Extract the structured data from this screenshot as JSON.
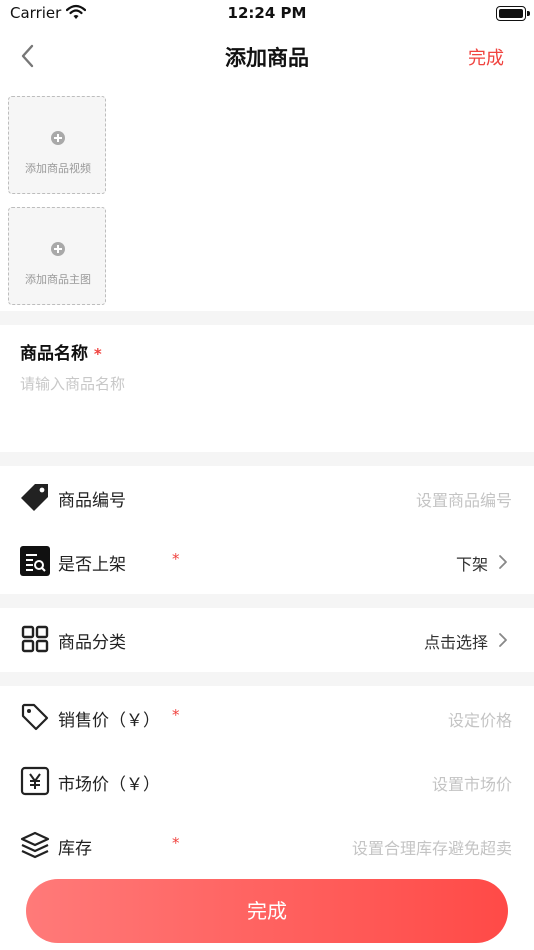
{
  "status_bar": {
    "carrier": "Carrier",
    "time": "12:24 PM",
    "wifi_icon": "wifi-icon",
    "battery_icon": "battery-icon"
  },
  "nav": {
    "back_icon": "chevron-left-icon",
    "title": "添加商品",
    "done_label": "完成"
  },
  "media": {
    "video_label": "添加商品视频",
    "image_label": "添加商品主图",
    "add_icon": "plus-circle-icon"
  },
  "name_field": {
    "label": "商品名称",
    "required_mark": "*",
    "placeholder": "请输入商品名称"
  },
  "rows": [
    {
      "icon": "tag-icon",
      "label": "商品编号",
      "value": "设置商品编号"
    },
    {
      "icon": "listing-icon",
      "label": "是否上架",
      "required_mark": "*",
      "value": "下架"
    },
    {
      "icon": "grid-icon",
      "label": "商品分类",
      "value": "点击选择"
    },
    {
      "icon": "price-tag-icon",
      "label": "销售价（￥）",
      "required_mark": "*",
      "value": "设定价格"
    },
    {
      "icon": "yen-icon",
      "label": "市场价（￥）",
      "value": "设置市场价"
    },
    {
      "icon": "layers-icon",
      "label": "库存",
      "required_mark": "*",
      "value": "设置合理库存避免超卖"
    }
  ],
  "submit": {
    "label": "完成"
  },
  "colors": {
    "accent": "#f0433f",
    "button_gradient_start": "#ff7a79",
    "button_gradient_end": "#ff4a47",
    "background": "#f5f5f5"
  }
}
